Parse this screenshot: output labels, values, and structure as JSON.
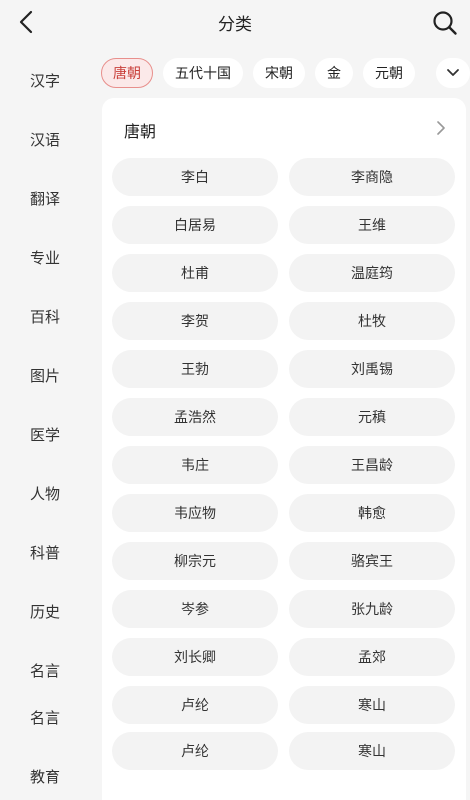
{
  "header": {
    "title": "分类"
  },
  "sidebar": {
    "items": [
      {
        "label": "汉字"
      },
      {
        "label": "汉语"
      },
      {
        "label": "翻译"
      },
      {
        "label": "专业"
      },
      {
        "label": "百科"
      },
      {
        "label": "图片"
      },
      {
        "label": "医学"
      },
      {
        "label": "人物"
      },
      {
        "label": "科普"
      },
      {
        "label": "历史"
      },
      {
        "label": "名言"
      },
      {
        "label": "名言"
      },
      {
        "label": "教育"
      }
    ]
  },
  "chips": [
    {
      "label": "唐朝",
      "active": true
    },
    {
      "label": "五代十国",
      "active": false
    },
    {
      "label": "宋朝",
      "active": false
    },
    {
      "label": "金",
      "active": false
    },
    {
      "label": "元朝",
      "active": false
    }
  ],
  "panel": {
    "title": "唐朝",
    "poets": [
      "李白",
      "李商隐",
      "白居易",
      "王维",
      "杜甫",
      "温庭筠",
      "李贺",
      "杜牧",
      "王勃",
      "刘禹锡",
      "孟浩然",
      "元稹",
      "韦庄",
      "王昌龄",
      "韦应物",
      "韩愈",
      "柳宗元",
      "骆宾王",
      "岑参",
      "张九龄",
      "刘长卿",
      "孟郊",
      "卢纶",
      "寒山",
      "卢纶",
      "寒山"
    ]
  },
  "colors": {
    "accent": "#c9403b",
    "active_chip_bg": "#fbe9e9",
    "background": "#f5f5f5",
    "panel_bg": "#ffffff",
    "cell_bg": "#f3f3f3"
  },
  "icons": {
    "back": "chevron-left-icon",
    "search": "search-icon",
    "more": "chevron-down-icon",
    "panel": "chevron-right-icon"
  }
}
